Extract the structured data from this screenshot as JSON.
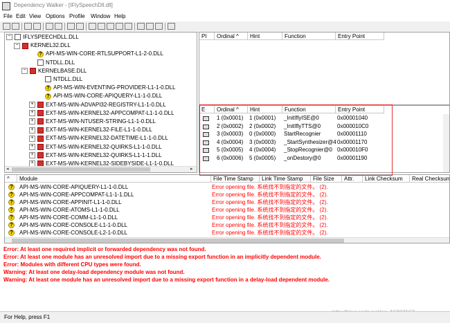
{
  "window": {
    "title": "Dependency Walker - [IFlySpeechDll.dll]"
  },
  "menu": [
    "File",
    "Edit",
    "View",
    "Options",
    "Profile",
    "Window",
    "Help"
  ],
  "tree": [
    {
      "label": "IFLYSPEECHDLL.DLL",
      "icon": "dll-icon",
      "indent": 0,
      "expander": "−"
    },
    {
      "label": "KERNEL32.DLL",
      "icon": "error-dll-icon",
      "indent": 1,
      "expander": "−"
    },
    {
      "label": "API-MS-WIN-CORE-RTLSUPPORT-L1-2-0.DLL",
      "icon": "warning-icon",
      "indent": 3,
      "expander": ""
    },
    {
      "label": "NTDLL.DLL",
      "icon": "dll-icon",
      "indent": 3,
      "expander": ""
    },
    {
      "label": "KERNELBASE.DLL",
      "icon": "error-dll-icon",
      "indent": 2,
      "expander": "−"
    },
    {
      "label": "NTDLL.DLL",
      "icon": "dll-icon",
      "indent": 4,
      "expander": ""
    },
    {
      "label": "API-MS-WIN-EVENTING-PROVIDER-L1-1-0.DLL",
      "icon": "warning-icon",
      "indent": 4,
      "expander": ""
    },
    {
      "label": "API-MS-WIN-CORE-APIQUERY-L1-1-0.DLL",
      "icon": "warning-icon",
      "indent": 4,
      "expander": ""
    },
    {
      "label": "EXT-MS-WIN-ADVAPI32-REGISTRY-L1-1-0.DLL",
      "icon": "error-dll-icon",
      "indent": 3,
      "expander": "+"
    },
    {
      "label": "EXT-MS-WIN-KERNEL32-APPCOMPAT-L1-1-0.DLL",
      "icon": "error-dll-icon",
      "indent": 3,
      "expander": "+"
    },
    {
      "label": "EXT-MS-WIN-NTUSER-STRING-L1-1-0.DLL",
      "icon": "error-dll-icon",
      "indent": 3,
      "expander": "+"
    },
    {
      "label": "EXT-MS-WIN-KERNEL32-FILE-L1-1-0.DLL",
      "icon": "error-dll-icon",
      "indent": 3,
      "expander": "+"
    },
    {
      "label": "EXT-MS-WIN-KERNEL32-DATETIME-L1-1-0.DLL",
      "icon": "error-dll-icon",
      "indent": 3,
      "expander": "+"
    },
    {
      "label": "EXT-MS-WIN-KERNEL32-QUIRKS-L1-1-0.DLL",
      "icon": "error-dll-icon",
      "indent": 3,
      "expander": "+"
    },
    {
      "label": "EXT-MS-WIN-KERNEL32-QUIRKS-L1-1-1.DLL",
      "icon": "error-dll-icon",
      "indent": 3,
      "expander": "+"
    },
    {
      "label": "EXT-MS-WIN-KERNEL32-SIDEBYSIDE-L1-1-0.DLL",
      "icon": "error-dll-icon",
      "indent": 3,
      "expander": "+"
    }
  ],
  "imports": {
    "headers": [
      "PI",
      "Ordinal ^",
      "Hint",
      "Function",
      "Entry Point"
    ]
  },
  "exports": {
    "headers": [
      "E",
      "Ordinal ^",
      "Hint",
      "Function",
      "Entry Point"
    ],
    "rows": [
      {
        "ordinal": "1 (0x0001)",
        "hint": "1 (0x0001)",
        "function": "_InitIflyISE@0",
        "entry": "0x00001040"
      },
      {
        "ordinal": "2 (0x0002)",
        "hint": "2 (0x0002)",
        "function": "_InitIflyTTS@0",
        "entry": "0x000010C0"
      },
      {
        "ordinal": "3 (0x0003)",
        "hint": "0 (0x0000)",
        "function": "StartRecognier",
        "entry": "0x00001110"
      },
      {
        "ordinal": "4 (0x0004)",
        "hint": "3 (0x0003)",
        "function": "_StartSynthesizer@4",
        "entry": "0x00001170"
      },
      {
        "ordinal": "5 (0x0005)",
        "hint": "4 (0x0004)",
        "function": "_StopRecognier@0",
        "entry": "0x000010F0"
      },
      {
        "ordinal": "6 (0x0006)",
        "hint": "5 (0x0005)",
        "function": "_onDestory@0",
        "entry": "0x00001190"
      }
    ]
  },
  "modules": {
    "headers": [
      "^",
      "Module",
      "File Time Stamp",
      "Link Time Stamp",
      "File Size",
      "Attr.",
      "Link Checksum",
      "Real Checksum"
    ],
    "rows": [
      {
        "name": "API-MS-WIN-CORE-APIQUERY-L1-1-0.DLL",
        "status": "Error opening file. 系统找不到指定的文件。 (2)."
      },
      {
        "name": "API-MS-WIN-CORE-APPCOMPAT-L1-1-1.DLL",
        "status": "Error opening file. 系统找不到指定的文件。 (2)."
      },
      {
        "name": "API-MS-WIN-CORE-APPINIT-L1-1-0.DLL",
        "status": "Error opening file. 系统找不到指定的文件。 (2)."
      },
      {
        "name": "API-MS-WIN-CORE-ATOMS-L1-1-0.DLL",
        "status": "Error opening file. 系统找不到指定的文件。 (2)."
      },
      {
        "name": "API-MS-WIN-CORE-COMM-L1-1-0.DLL",
        "status": "Error opening file. 系统找不到指定的文件。 (2)."
      },
      {
        "name": "API-MS-WIN-CORE-CONSOLE-L1-1-0.DLL",
        "status": "Error opening file. 系统找不到指定的文件。 (2)."
      },
      {
        "name": "API-MS-WIN-CORE-CONSOLE-L2-1-0.DLL",
        "status": "Error opening file. 系统找不到指定的文件。 (2)."
      }
    ]
  },
  "log": [
    "Error: At least one required implicit or forwarded dependency was not found.",
    "Error: At least one module has an unresolved import due to a missing export function in an implicitly dependent module.",
    "Error: Modules with different CPU types were found.",
    "Warning: At least one delay-load dependency module was not found.",
    "Warning: At least one module has an unresolved import due to a missing export function in a delay-load dependent module."
  ],
  "status": {
    "text": "For Help, press F1"
  },
  "watermark": "http://blog.csdn.net/qq_15807167",
  "colors": {
    "error": "#ff0000",
    "highlight_box": "#e53030",
    "toolbar": "#f0f0f0"
  }
}
